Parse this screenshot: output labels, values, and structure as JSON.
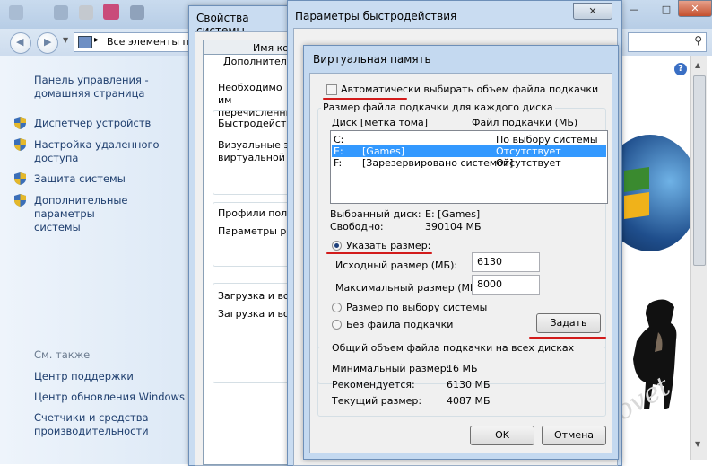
{
  "explorer": {
    "breadcrumb": "Все элементы па",
    "left": {
      "home_link": "Панель управления -\nдомашняя страница",
      "links": [
        "Диспетчер устройств",
        "Настройка удаленного\nдоступа",
        "Защита системы",
        "Дополнительные параметры\nсистемы"
      ],
      "see_also_title": "См. также",
      "see_also": [
        "Центр поддержки",
        "Центр обновления Windows",
        "Счетчики и средства\nпроизводительности"
      ]
    },
    "watermark": "Sovet"
  },
  "sysprops": {
    "title": "Свойства системы",
    "tab_label": "Имя ко",
    "tab_additional": "Дополнительн",
    "intro": "Необходимо им\nперечисленны",
    "group_perf": "Быстродейств",
    "perf_text": "Визуальные э\nвиртуальной п",
    "group_profiles": "Профили поль",
    "profiles_text": "Параметры ра",
    "group_boot": "Загрузка и во",
    "boot_text": "Загрузка и во"
  },
  "perfopts": {
    "title": "Параметры быстродействия"
  },
  "vm": {
    "title": "Виртуальная память",
    "auto_checkbox": "Автоматически выбирать объем файла подкачки",
    "auto_checked": false,
    "group_title": "Размер файла подкачки для каждого диска",
    "col_disk": "Диск [метка тома]",
    "col_file": "Файл подкачки (МБ)",
    "drives": [
      {
        "disk": "C:",
        "label": "",
        "file": "По выбору системы",
        "selected": false
      },
      {
        "disk": "E:",
        "label": "[Games]",
        "file": "Отсутствует",
        "selected": true
      },
      {
        "disk": "F:",
        "label": "[Зарезервировано системой]",
        "file": "Отсутствует",
        "selected": false
      }
    ],
    "selected_disk_label": "Выбранный диск:",
    "selected_disk_value": "E:  [Games]",
    "free_label": "Свободно:",
    "free_value": "390104 МБ",
    "radio_custom": "Указать размер:",
    "initial_label": "Исходный размер (МБ):",
    "initial_value": "6130",
    "max_label": "Максимальный размер (МБ):",
    "max_value": "8000",
    "radio_system": "Размер по выбору системы",
    "radio_none": "Без файла подкачки",
    "set_button": "Задать",
    "total_group_title": "Общий объем файла подкачки на всех дисках",
    "min_label": "Минимальный размер:",
    "min_value": "16 МБ",
    "rec_label": "Рекомендуется:",
    "rec_value": "6130 МБ",
    "cur_label": "Текущий размер:",
    "cur_value": "4087 МБ",
    "ok_button": "OK",
    "cancel_button": "Отмена"
  },
  "colors": {
    "accent_red": "#d21b1b",
    "link_blue": "#1e3e6e",
    "selection_blue": "#3399ff"
  }
}
